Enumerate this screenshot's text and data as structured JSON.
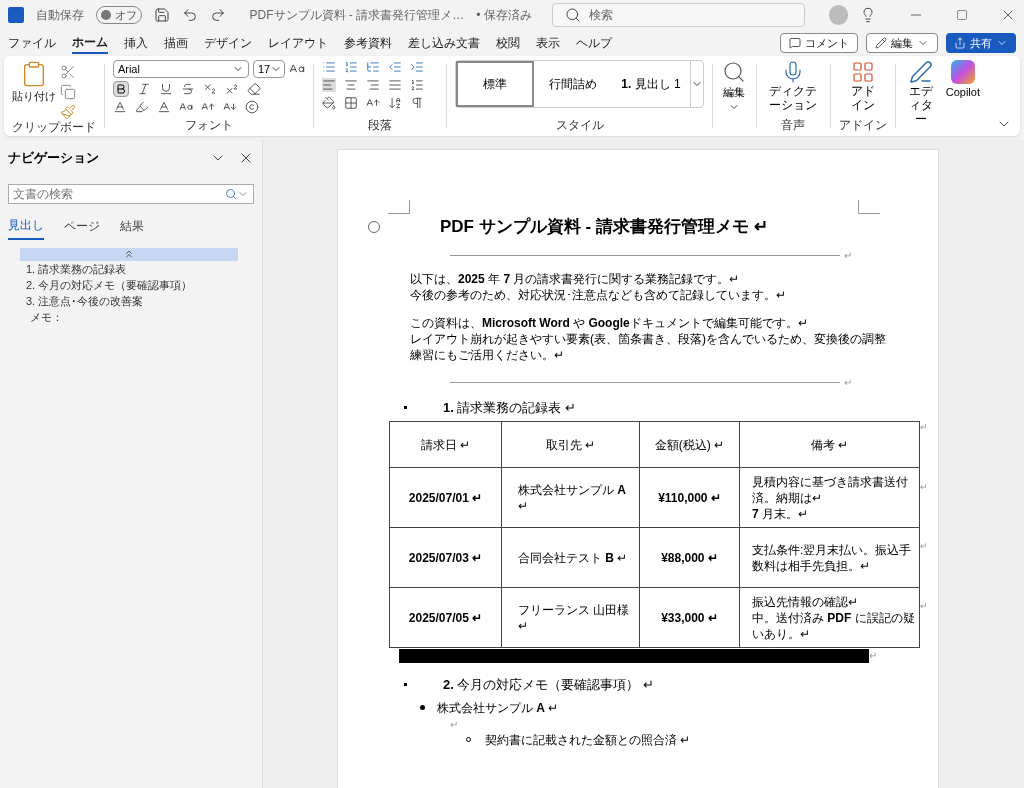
{
  "title_bar": {
    "autosave_label": "自動保存",
    "autosave": {
      "on": false,
      "label": "オフ"
    },
    "doc_title": "PDFサンプル資料 - 請求書発行管理メ…",
    "save_status": "• 保存済み",
    "search_placeholder": "検索"
  },
  "menu_tabs": [
    {
      "label": "ファイル",
      "selected": false
    },
    {
      "label": "ホーム",
      "selected": true
    },
    {
      "label": "挿入",
      "selected": false
    },
    {
      "label": "描画",
      "selected": false
    },
    {
      "label": "デザイン",
      "selected": false
    },
    {
      "label": "レイアウト",
      "selected": false
    },
    {
      "label": "参考資料",
      "selected": false
    },
    {
      "label": "差し込み文書",
      "selected": false
    },
    {
      "label": "校閲",
      "selected": false
    },
    {
      "label": "表示",
      "selected": false
    },
    {
      "label": "ヘルプ",
      "selected": false
    }
  ],
  "actions": {
    "comment": "コメント",
    "edit": "編集",
    "share": "共有"
  },
  "ribbon": {
    "paste": "貼り付け",
    "clipboard_label": "クリップボード",
    "font_name": "Arial",
    "font_size": "17",
    "font_label": "フォント",
    "paragraph_label": "段落",
    "styles": [
      {
        "label": "標準",
        "selected": true
      },
      {
        "label": "行間詰め",
        "selected": false
      },
      {
        "label": "**1.**  見出し 1",
        "selected": false
      }
    ],
    "styles_label": "スタイル",
    "editing": "編集",
    "dictation": "ディクテーション",
    "voice_label": "音声",
    "addin": "アドイン",
    "addin_label": "アドイン",
    "editor": "エディター",
    "copilot": "Copilot"
  },
  "navigation": {
    "title": "ナビゲーション",
    "search_placeholder": "文書の検索",
    "tabs": [
      {
        "label": "見出し",
        "selected": true
      },
      {
        "label": "ページ",
        "selected": false
      },
      {
        "label": "結果",
        "selected": false
      }
    ],
    "headings": [
      "1. 請求業務の記録表",
      "2. 今月の対応メモ（要確認事項）",
      "3. 注意点･今後の改善案",
      "メモ："
    ]
  },
  "document": {
    "blocks": [
      {
        "kind": "title",
        "text": "PDF サンプル資料 - 請求書発行管理メモ ↵"
      },
      {
        "kind": "rule",
        "text": "↵"
      },
      {
        "kind": "para",
        "text": "以下は、**2025** 年 **7** 月の請求書発行に関する業務記録です。↵\n 今後の参考のため、対応状況･注意点なども含めて記録しています。↵"
      },
      {
        "kind": "para",
        "text": "この資料は、**Microsoft Word** や **Google**ドキュメントで編集可能です。↵\nレイアウト崩れが起きやすい要素(表、箇条書き、段落)を含んでいるため、変換後の調整練習にもご活用ください。↵"
      },
      {
        "kind": "rule",
        "text": "↵"
      },
      {
        "kind": "heading",
        "text": "**1.** 請求業務の記録表 ↵"
      },
      {
        "kind": "table",
        "columns": [
          "請求日 ↵",
          "取引先 ↵",
          "金額(税込) ↵",
          "備考 ↵"
        ],
        "rows": [
          [
            "2025/07/01 ↵",
            "株式会社サンプル **A** ↵",
            "¥110,000 ↵",
            "見積内容に基づき請求書送付済。納期は↵\n**7** 月末。↵"
          ],
          [
            "2025/07/03 ↵",
            "合同会社テスト **B** ↵",
            "¥88,000 ↵",
            "支払条件:翌月末払い。振込手数料は相手先負担。↵"
          ],
          [
            "2025/07/05 ↵",
            "フリーランス 山田様 ↵",
            "¥33,000 ↵",
            "振込先情報の確認↵\n中。送付済み **PDF** に誤記の疑いあり。↵"
          ]
        ],
        "end_marks": [
          "↵",
          "↵",
          "↵",
          "↵"
        ]
      },
      {
        "kind": "bar",
        "text": "↵"
      },
      {
        "kind": "heading",
        "text": "**2.** 今月の対応メモ（要確認事項） ↵"
      },
      {
        "kind": "bullet",
        "text": "株式会社サンプル **A** ↵"
      },
      {
        "kind": "empty",
        "text": "↵"
      },
      {
        "kind": "subbullet",
        "text": "契約書に記載された金額との照合済 ↵"
      }
    ]
  }
}
